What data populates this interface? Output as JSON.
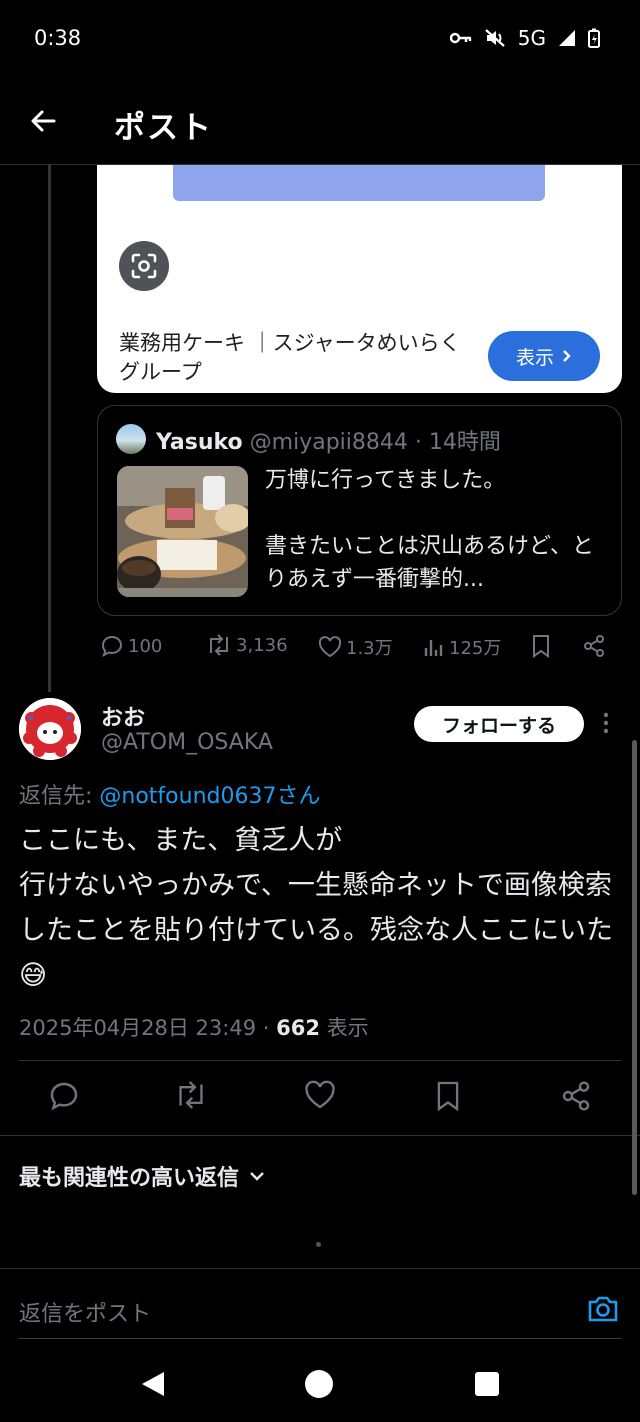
{
  "status_bar": {
    "time": "0:38",
    "network": "5G"
  },
  "header": {
    "title": "ポスト"
  },
  "link_card": {
    "title": "業務用ケーキ ｜スジャータめいらくグループ",
    "show_label": "表示",
    "band_color": "#8fa6ef"
  },
  "quoted_post": {
    "name": "Yasuko",
    "handle": "@miyapii8844",
    "time": "14時間",
    "line1": "万博に行ってきました。",
    "line2": "書きたいことは沢山あるけど、とりあえず一番衝撃的..."
  },
  "parent_actions": {
    "replies": "100",
    "reposts": "3,136",
    "likes": "1.3万",
    "views": "125万"
  },
  "reply": {
    "name": "おお",
    "handle": "@ATOM_OSAKA",
    "follow_label": "フォローする",
    "reply_to_prefix": "返信先: ",
    "reply_to_user": "@notfound0637さん",
    "body": "ここにも、また、貧乏人が\n行けないやっかみで、一生懸命ネットで画像検索したことを貼り付けている。残念な人ここにいた😅",
    "timestamp": "2025年04月28日 23:49",
    "views_count": "662",
    "views_label": "表示"
  },
  "replies_sort": {
    "label": "最も関連性の高い返信"
  },
  "compose": {
    "placeholder": "返信をポスト"
  },
  "colors": {
    "accent": "#1d9bf0",
    "show_button": "#2b6fdc"
  }
}
